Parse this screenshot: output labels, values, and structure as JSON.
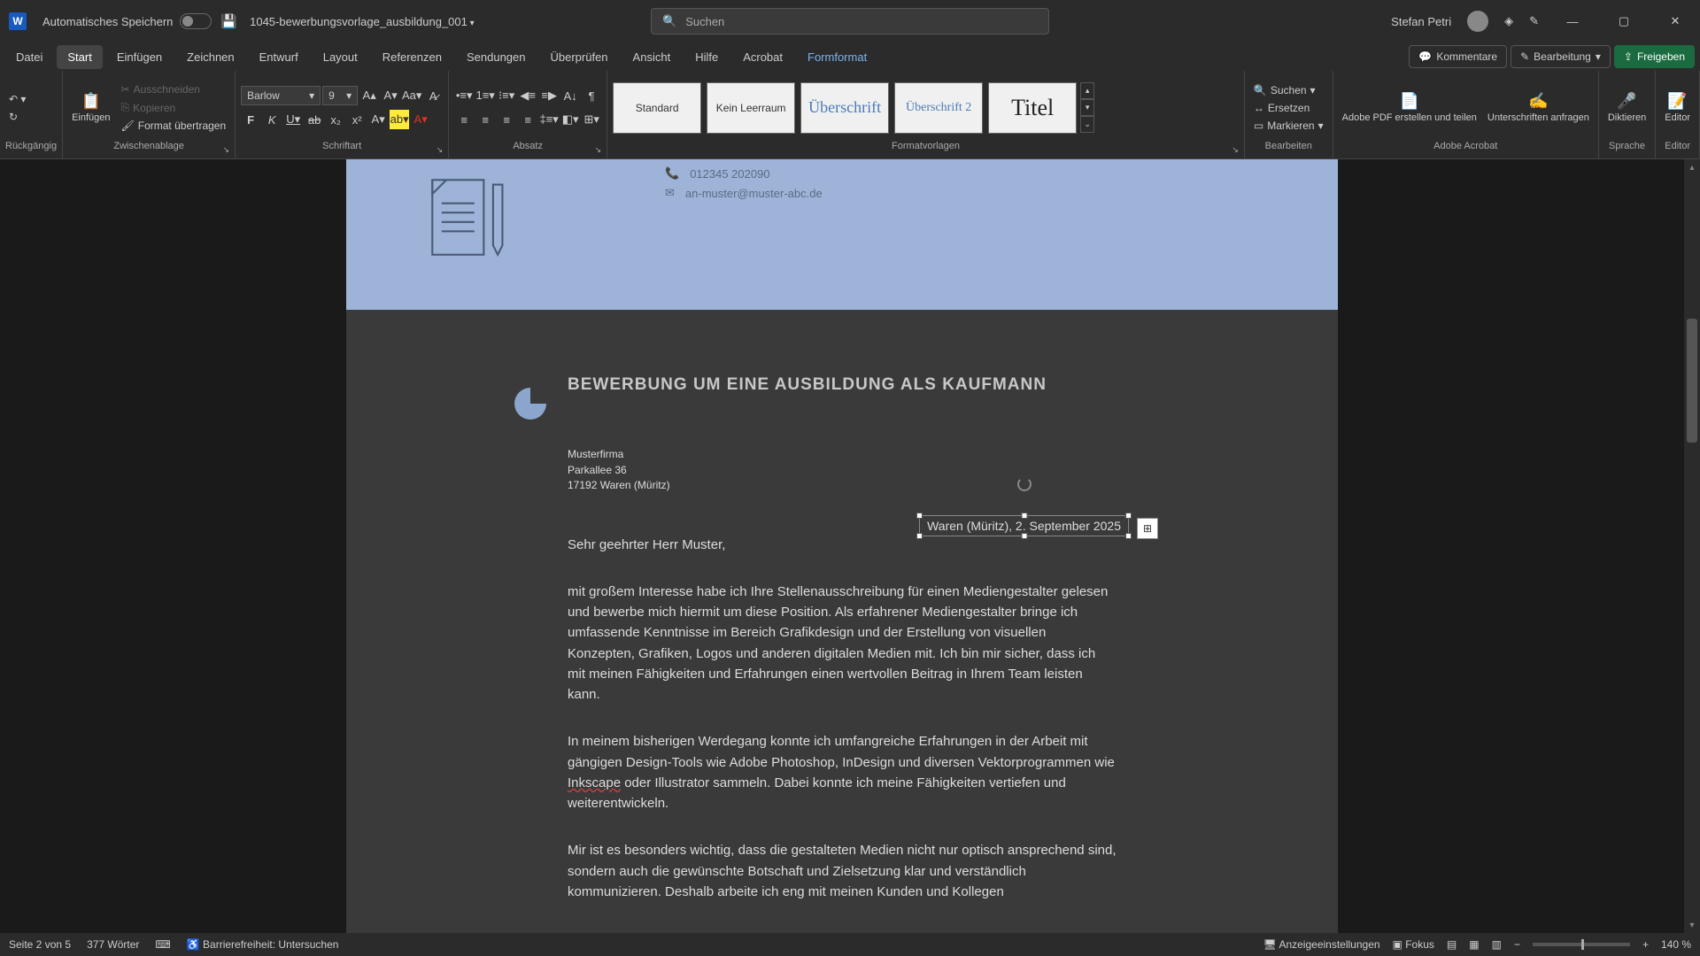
{
  "titlebar": {
    "autosave_label": "Automatisches Speichern",
    "doc_name": "1045-bewerbungsvorlage_ausbildung_001",
    "search_placeholder": "Suchen",
    "user_name": "Stefan Petri"
  },
  "tabs": {
    "items": [
      "Datei",
      "Start",
      "Einfügen",
      "Zeichnen",
      "Entwurf",
      "Layout",
      "Referenzen",
      "Sendungen",
      "Überprüfen",
      "Ansicht",
      "Hilfe",
      "Acrobat",
      "Formformat"
    ],
    "comments": "Kommentare",
    "editing": "Bearbeitung",
    "share": "Freigeben"
  },
  "ribbon": {
    "undo_label": "Rückgängig",
    "paste": "Einfügen",
    "cut": "Ausschneiden",
    "copy": "Kopieren",
    "format_painter": "Format übertragen",
    "clipboard_label": "Zwischenablage",
    "font_name": "Barlow",
    "font_size": "9",
    "font_label": "Schriftart",
    "para_label": "Absatz",
    "styles": [
      "Standard",
      "Kein Leerraum",
      "Überschrift",
      "Überschrift 2",
      "Titel"
    ],
    "styles_label": "Formatvorlagen",
    "find": "Suchen",
    "replace": "Ersetzen",
    "select": "Markieren",
    "edit_label": "Bearbeiten",
    "adobe_create": "Adobe PDF erstellen und teilen",
    "adobe_sign": "Unterschriften anfragen",
    "adobe_label": "Adobe Acrobat",
    "dictate": "Diktieren",
    "dictate_label": "Sprache",
    "editor": "Editor",
    "editor_label": "Editor"
  },
  "document": {
    "phone": "012345 202090",
    "email": "an-muster@muster-abc.de",
    "heading": "BEWERBUNG UM EINE AUSBILDUNG ALS KAUFMANN",
    "company": "Musterfirma",
    "street": "Parkallee 36",
    "city": "17192 Waren (Müritz)",
    "date_loc": "Waren (Müritz), 2. September 2025",
    "greeting": "Sehr geehrter Herr Muster,",
    "para1": "mit großem Interesse habe ich Ihre Stellenausschreibung für einen Mediengestalter gelesen und bewerbe mich hiermit um diese Position. Als erfahrener Mediengestalter bringe ich umfassende Kenntnisse im Bereich Grafikdesign und der Erstellung von visuellen Konzepten, Grafiken, Logos und anderen digitalen Medien mit. Ich bin mir sicher, dass ich mit meinen Fähigkeiten und Erfahrungen einen wertvollen Beitrag in Ihrem Team leisten kann.",
    "para2a": "In meinem bisherigen Werdegang konnte ich umfangreiche Erfahrungen in der Arbeit mit gängigen Design-Tools wie Adobe Photoshop, InDesign und diversen Vektorprogrammen wie ",
    "para2b": "Inkscape",
    "para2c": " oder Illustrator sammeln. Dabei konnte ich meine Fähigkeiten vertiefen und weiterentwickeln.",
    "para3": "Mir ist es besonders wichtig, dass die gestalteten Medien nicht nur optisch ansprechend sind, sondern auch die gewünschte Botschaft und Zielsetzung klar und verständlich kommunizieren. Deshalb arbeite ich eng mit meinen Kunden und Kollegen"
  },
  "statusbar": {
    "page": "Seite 2 von 5",
    "words": "377 Wörter",
    "a11y": "Barrierefreiheit: Untersuchen",
    "display": "Anzeigeeinstellungen",
    "focus": "Fokus",
    "zoom": "140 %"
  }
}
